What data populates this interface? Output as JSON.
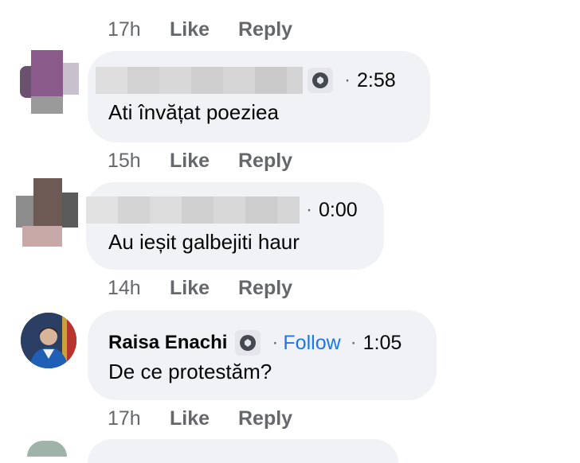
{
  "comments": [
    {
      "time_ago": "17h",
      "like_label": "Like",
      "reply_label": "Reply"
    },
    {
      "author": "",
      "timestamp": "2:58",
      "text": "Ati învățat poeziea",
      "time_ago": "15h",
      "like_label": "Like",
      "reply_label": "Reply"
    },
    {
      "author": "",
      "timestamp": "0:00",
      "text": "Au ieșit galbejiti haur",
      "time_ago": "14h",
      "like_label": "Like",
      "reply_label": "Reply"
    },
    {
      "author": "Raisa Enachi",
      "follow_label": "Follow",
      "timestamp": "1:05",
      "text": "De ce protestăm?",
      "time_ago": "17h",
      "like_label": "Like",
      "reply_label": "Reply"
    }
  ],
  "separator": "·",
  "colors": {
    "bubble_bg": "#f0f2f5",
    "meta_gray": "#65676b",
    "follow_blue": "#1877f2",
    "badge_bg": "#e4e6eb"
  },
  "icons": {
    "badge": "top-fan-badge-icon"
  }
}
